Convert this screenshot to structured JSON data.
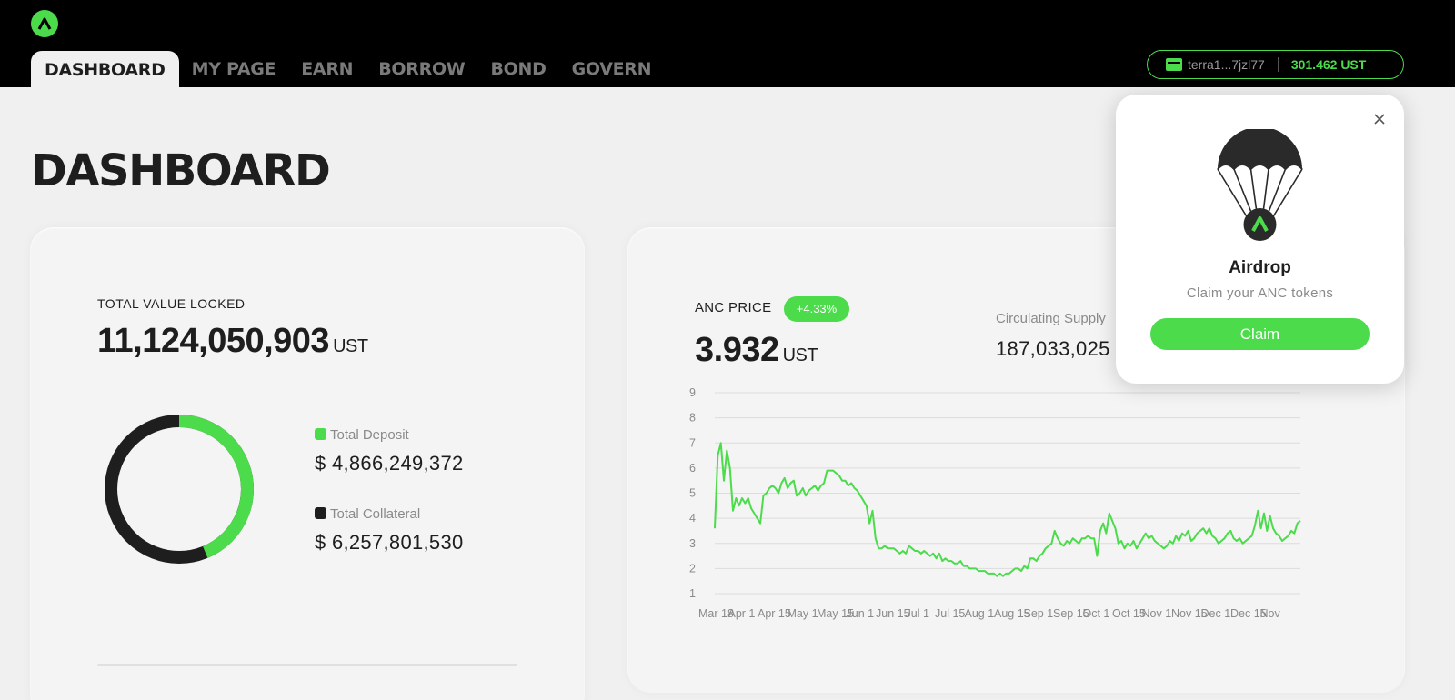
{
  "nav": {
    "items": [
      {
        "label": "DASHBOARD",
        "active": true
      },
      {
        "label": "MY PAGE",
        "active": false
      },
      {
        "label": "EARN",
        "active": false
      },
      {
        "label": "BORROW",
        "active": false
      },
      {
        "label": "BOND",
        "active": false
      },
      {
        "label": "GOVERN",
        "active": false
      }
    ]
  },
  "wallet": {
    "address": "terra1...7jzl77",
    "balance": "301.462 UST",
    "icon": "wallet-icon"
  },
  "page": {
    "title": "DASHBOARD"
  },
  "tvl": {
    "label": "TOTAL VALUE LOCKED",
    "value": "11,124,050,903",
    "unit": "UST",
    "deposit": {
      "label": "Total Deposit",
      "value": "$ 4,866,249,372",
      "color": "#4bdb4b"
    },
    "collateral": {
      "label": "Total Collateral",
      "value": "$ 6,257,801,530",
      "color": "#1e1e1e"
    },
    "deposit_share": 0.4374
  },
  "anc": {
    "label": "ANC PRICE",
    "change": "+4.33%",
    "price": "3.932",
    "unit": "UST",
    "supply_label": "Circulating Supply",
    "supply_value": "187,033,025"
  },
  "chart_data": {
    "type": "line",
    "x_labels": [
      "Mar 18",
      "Apr 1",
      "Apr 15",
      "May 1",
      "May 15",
      "Jun 1",
      "Jun 15",
      "Jul 1",
      "Jul 15",
      "Aug 1",
      "Aug 15",
      "Sep 1",
      "Sep 15",
      "Oct 1",
      "Oct 15",
      "Nov 1",
      "Nov 15",
      "Dec 1",
      "Dec 15",
      "Nov"
    ],
    "y_ticks": [
      1,
      2,
      3,
      4,
      5,
      6,
      7,
      8,
      9
    ],
    "ylim": [
      1,
      9
    ],
    "grid": true,
    "color": "#4bdb4b",
    "series": [
      {
        "values": [
          3.6,
          6.5,
          7.0,
          5.5,
          6.7,
          6.0,
          4.3,
          4.8,
          4.5,
          4.8,
          4.6,
          4.8,
          4.4,
          4.2,
          4.0,
          3.8,
          4.9,
          5.0,
          5.2,
          5.3,
          5.2,
          5.0,
          5.4,
          5.6,
          5.2,
          5.4,
          5.5,
          4.9,
          5.0,
          5.2,
          4.9,
          5.1,
          5.2,
          5.3,
          5.1,
          5.3,
          5.4,
          5.9,
          5.9,
          5.9,
          5.8,
          5.7,
          5.5,
          5.5,
          5.3,
          5.4,
          5.2,
          5.1,
          4.9,
          4.7,
          4.5,
          3.8,
          4.3,
          3.2,
          2.8,
          2.8,
          2.9,
          2.8,
          2.8,
          2.8,
          2.7,
          2.6,
          2.7,
          2.6,
          2.9,
          2.8,
          2.7,
          2.7,
          2.6,
          2.7,
          2.6,
          2.5,
          2.6,
          2.4,
          2.6,
          2.3,
          2.4,
          2.3,
          2.3,
          2.2,
          2.2,
          2.3,
          2.1,
          2.1,
          2.0,
          2.0,
          2.0,
          1.9,
          1.9,
          1.9,
          1.8,
          1.8,
          1.8,
          1.7,
          1.8,
          1.7,
          1.8,
          1.8,
          1.9,
          2.0,
          2.0,
          1.9,
          2.1,
          2.0,
          2.4,
          2.4,
          2.3,
          2.5,
          2.6,
          2.8,
          2.9,
          3.0,
          3.5,
          3.2,
          3.0,
          2.9,
          3.1,
          3.0,
          3.2,
          3.1,
          3.0,
          3.2,
          3.2,
          3.3,
          3.2,
          3.2,
          2.5,
          3.5,
          3.8,
          3.4,
          4.2,
          3.9,
          3.6,
          3.0,
          3.1,
          2.8,
          3.0,
          2.9,
          3.1,
          2.8,
          3.0,
          3.2,
          3.4,
          3.2,
          3.3,
          3.1,
          3.0,
          2.9,
          2.8,
          2.9,
          3.1,
          3.0,
          3.3,
          3.1,
          3.4,
          3.3,
          3.5,
          3.1,
          3.2,
          3.4,
          3.5,
          3.6,
          3.4,
          3.6,
          3.3,
          3.2,
          3.0,
          3.1,
          3.2,
          3.4,
          3.5,
          3.2,
          3.1,
          3.2,
          3.0,
          3.1,
          3.2,
          3.3,
          3.7,
          4.3,
          3.6,
          4.2,
          3.5,
          4.1,
          3.6,
          3.4,
          3.3,
          3.1,
          3.2,
          3.3,
          3.5,
          3.4,
          3.8,
          3.9
        ]
      }
    ]
  },
  "airdrop": {
    "title": "Airdrop",
    "subtitle": "Claim your ANC tokens",
    "button": "Claim",
    "close_icon": "close-icon"
  }
}
